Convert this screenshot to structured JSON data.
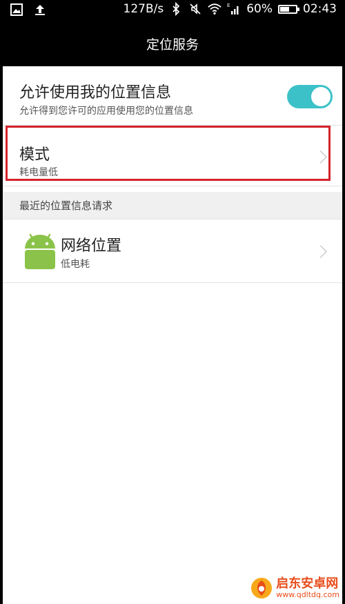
{
  "status_bar": {
    "speed": "127B/s",
    "battery_text": "60%",
    "battery_level": 0.6,
    "time": "02:43",
    "signal_label": "E",
    "icons": [
      "picture-icon",
      "upload-icon",
      "bluetooth-icon",
      "mute-icon",
      "wifi-icon",
      "signal-icon",
      "battery-icon"
    ]
  },
  "header": {
    "title": "定位服务"
  },
  "settings": {
    "location_access": {
      "title": "允许使用我的位置信息",
      "subtitle": "允许得到您许可的应用使用您的位置信息",
      "enabled": true
    },
    "mode": {
      "title": "模式",
      "value": "耗电量低"
    }
  },
  "recent_requests": {
    "header": "最近的位置信息请求",
    "items": [
      {
        "name": "网络位置",
        "usage": "低电耗",
        "icon": "android-icon"
      }
    ]
  },
  "watermark": {
    "name": "启东安卓网",
    "url": "www.qdltdq.com"
  },
  "colors": {
    "toggle_on": "#3cc1c8",
    "highlight": "#d4222a",
    "android_green": "#8bc34a",
    "watermark": "#e84e1b"
  }
}
